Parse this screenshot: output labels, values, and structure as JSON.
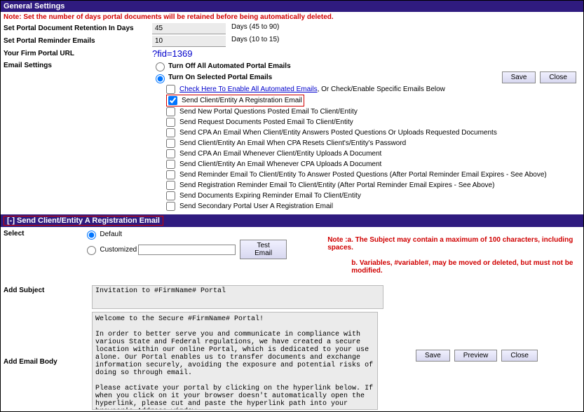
{
  "general": {
    "title": "General Settings",
    "warning": "Note: Set the number of days portal documents will be retained before being automatically deleted.",
    "retention_label": "Set Portal Document Retention In Days",
    "retention_value": "45",
    "retention_hint": "Days (45 to 90)",
    "reminder_label": "Set Portal Reminder Emails",
    "reminder_value": "10",
    "reminder_hint": "Days (10 to 15)",
    "url_label": "Your Firm Portal URL",
    "url_value": "?fid=1369",
    "email_settings_label": "Email Settings",
    "radio_off": "Turn Off All Automated Portal Emails",
    "radio_on": "Turn On Selected Portal Emails",
    "save_label": "Save",
    "close_label": "Close",
    "check_all_link": "Check Here To Enable All Automated Emails",
    "check_all_suffix": ", Or Check/Enable Specific Emails Below",
    "email_options": [
      "Send Client/Entity A Registration Email",
      "Send New Portal Questions Posted Email To Client/Entity",
      "Send Request Documents Posted Email To Client/Entity",
      "Send CPA An Email When Client/Entity Answers Posted Questions Or Uploads Requested Documents",
      "Send Client/Entity An Email When CPA Resets Client's/Entity's Password",
      "Send CPA An Email Whenever Client/Entity Uploads A Document",
      "Send Client/Entity An Email Whenever CPA Uploads A Document",
      "Send Reminder Email To Client/Entity To Answer Posted Questions (After Portal Reminder Email Expires - See Above)",
      "Send Registration Reminder Email To Client/Entity (After Portal Reminder Email Expires - See Above)",
      "Send Documents Expiring Reminder Email To Client/Entity",
      "Send Secondary Portal User A Registration Email"
    ]
  },
  "subsection": {
    "title_prefix": "[-] ",
    "title": "Send Client/Entity A Registration Email",
    "select_label": "Select",
    "default_label": "Default",
    "customized_label": "Customized",
    "test_email_label": "Test Email",
    "note_a": "Note :a. The Subject may contain a maximum of 100 characters, including spaces.",
    "note_b": "b. Variables, #variable#, may be moved or deleted, but must not be modified.",
    "subject_label": "Add Subject",
    "subject_value": "Invitation to #FirmName# Portal",
    "body_label": "Add Email Body",
    "body_value": "Welcome to the Secure #FirmName# Portal!\n\nIn order to better serve you and communicate in compliance with various State and Federal regulations, we have created a secure location within our online Portal, which is dedicated to your use alone. Our Portal enables us to transfer documents and exchange information securely, avoiding the exposure and potential risks of doing so through email.\n\nPlease activate your portal by clicking on the hyperlink below. If when you click on it your browser doesn't automatically open the hyperlink, please cut and paste the hyperlink path into your browser's Address window.\n\n#PortalRegistrationURLLink#",
    "save_label": "Save",
    "preview_label": "Preview",
    "close_label": "Close"
  }
}
